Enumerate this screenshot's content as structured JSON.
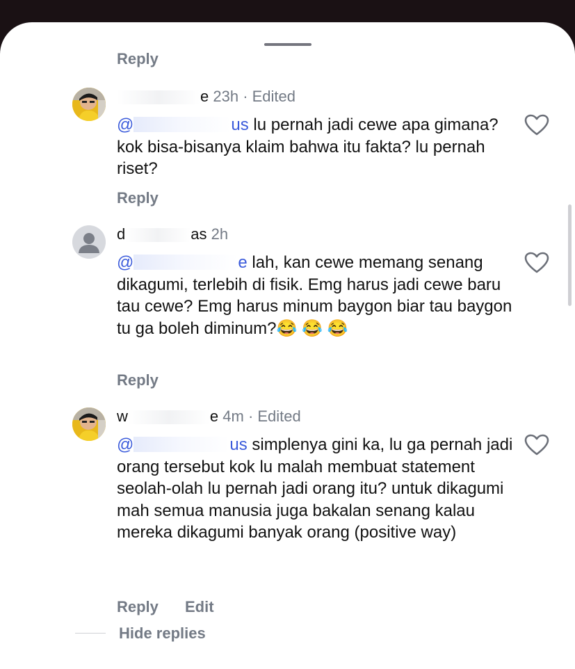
{
  "top_reply_label": "Reply",
  "comments": [
    {
      "name": "",
      "name_tail": "e",
      "meta": "23h · Edited",
      "mention": "@",
      "mention_tail": "us",
      "text": " lu pernah jadi cewe apa gimana? kok bisa-bisanya klaim bahwa itu fakta? lu pernah riset?",
      "reply_label": "Reply"
    },
    {
      "name": "d",
      "name_tail": "as",
      "meta": "2h",
      "mention": "@",
      "mention_tail": "e",
      "text": " lah, kan cewe memang senang dikagumi, terlebih di fisik. Emg harus jadi cewe baru tau cewe?  Emg harus minum baygon biar tau baygon tu ga boleh diminum?",
      "emoji": "😂 😂 😂",
      "reply_label": "Reply"
    },
    {
      "name": "w",
      "name_tail": "e",
      "meta": "4m · Edited",
      "mention": "@",
      "mention_tail": "us",
      "text": " simplenya gini ka, lu ga pernah jadi orang tersebut kok lu malah membuat statement seolah-olah lu pernah jadi orang itu? untuk dikagumi mah semua manusia juga bakalan senang kalau mereka dikagumi banyak orang (positive way)",
      "reply_label": "Reply",
      "edit_label": "Edit"
    }
  ],
  "hide_replies_label": "Hide replies",
  "icons": {
    "heart": "heart-outline-icon",
    "handle": "drag-handle",
    "avatar_default": "default-avatar-icon"
  },
  "colors": {
    "background_dark": "#1a1114",
    "sheet": "#ffffff",
    "text_primary": "#111111",
    "text_secondary": "#737a85",
    "mention": "#3b5bdb"
  }
}
